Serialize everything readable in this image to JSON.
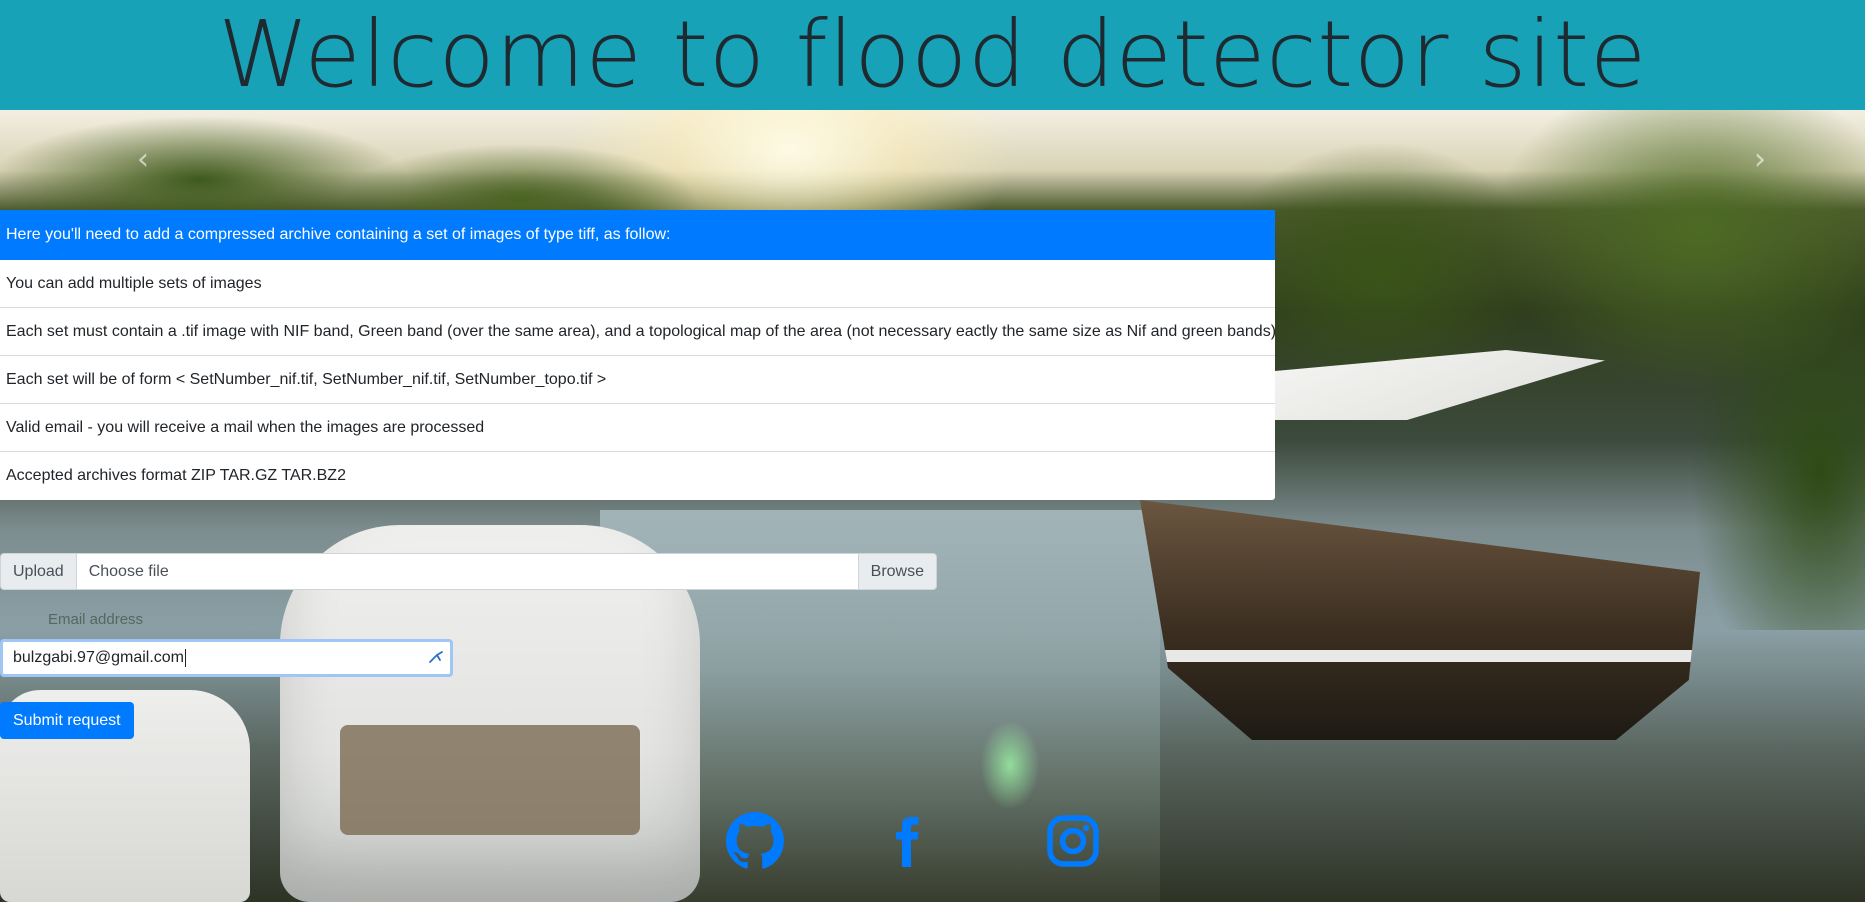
{
  "header": {
    "title": "Welcome to flood detector site"
  },
  "carousel": {
    "prev_icon": "chevron-left-icon",
    "next_icon": "chevron-right-icon",
    "prev_glyph": "‹",
    "next_glyph": "›"
  },
  "info": {
    "items": [
      "Here you'll need to add a compressed archive containing a set of images of type tiff, as follow:",
      "You can add multiple sets of images",
      "Each set must contain a .tif image with NIF band, Green band (over the same area), and a topological map of the area (not necessary eactly the same size as Nif and green bands)",
      "Each set will be of form < SetNumber_nif.tif, SetNumber_nif.tif, SetNumber_topo.tif >",
      "Valid email - you will receive a mail when the images are processed",
      "Accepted archives format ZIP TAR.GZ TAR.BZ2"
    ]
  },
  "upload": {
    "prefix_label": "Upload",
    "file_placeholder": "Choose file",
    "browse_label": "Browse"
  },
  "email": {
    "label": "Email address",
    "value": "bulzgabi.97@gmail.com"
  },
  "form": {
    "submit_label": "Submit request"
  },
  "social": [
    {
      "name": "github-icon",
      "color": "#007bff"
    },
    {
      "name": "facebook-icon",
      "color": "#007bff"
    },
    {
      "name": "instagram-icon",
      "color": "#007bff"
    }
  ],
  "colors": {
    "header_bg": "#17a2b8",
    "accent": "#007bff"
  }
}
